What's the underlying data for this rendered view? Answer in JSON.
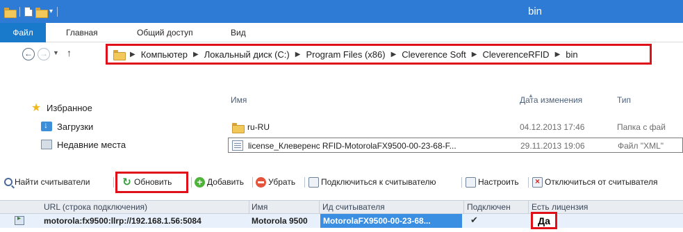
{
  "window": {
    "title": "bin"
  },
  "ribbon": {
    "tabs": [
      {
        "label": "Файл"
      },
      {
        "label": "Главная"
      },
      {
        "label": "Общий доступ"
      },
      {
        "label": "Вид"
      }
    ]
  },
  "address": {
    "crumbs": [
      "Компьютер",
      "Локальный диск (C:)",
      "Program Files (x86)",
      "Cleverence Soft",
      "CleverenceRFID",
      "bin"
    ]
  },
  "navigation": {
    "items": [
      {
        "label": "Избранное",
        "icon": "star-icon"
      },
      {
        "label": "Загрузки",
        "icon": "downloads-icon"
      },
      {
        "label": "Недавние места",
        "icon": "recent-places-icon"
      }
    ]
  },
  "files": {
    "columns": {
      "name": "Имя",
      "date": "Дата изменения",
      "type": "Тип"
    },
    "rows": [
      {
        "name": "ru-RU",
        "date": "04.12.2013 17:46",
        "type": "Папка с фай",
        "icon": "folder-icon"
      },
      {
        "name": "license_Клеверенс RFID-MotorolaFX9500-00-23-68-F...",
        "date": "29.11.2013 19:06",
        "type": "Файл \"XML\"",
        "icon": "xml-file-icon"
      }
    ]
  },
  "toolbar": {
    "find_label": "Найти считыватели",
    "refresh_label": "Обновить",
    "add_label": "Добавить",
    "remove_label": "Убрать",
    "connect_label": "Подключиться к считывателю",
    "settings_label": "Настроить",
    "disconnect_label": "Отключиться от считывателя"
  },
  "readers": {
    "columns": {
      "url": "URL (строка подключения)",
      "name": "Имя",
      "id": "Ид считывателя",
      "connected": "Подключен",
      "license": "Есть лицензия"
    },
    "rows": [
      {
        "url": "motorola:fx9500:llrp://192.168.1.56:5084",
        "name": "Motorola 9500",
        "id": "MotorolaFX9500-00-23-68...",
        "connected": "✔",
        "license": "Да"
      }
    ]
  },
  "colors": {
    "titlebar": "#2e7bd6",
    "file_tab": "#1979ca",
    "highlight_border": "#e0101b",
    "selected_cell": "#3b8fe2"
  }
}
